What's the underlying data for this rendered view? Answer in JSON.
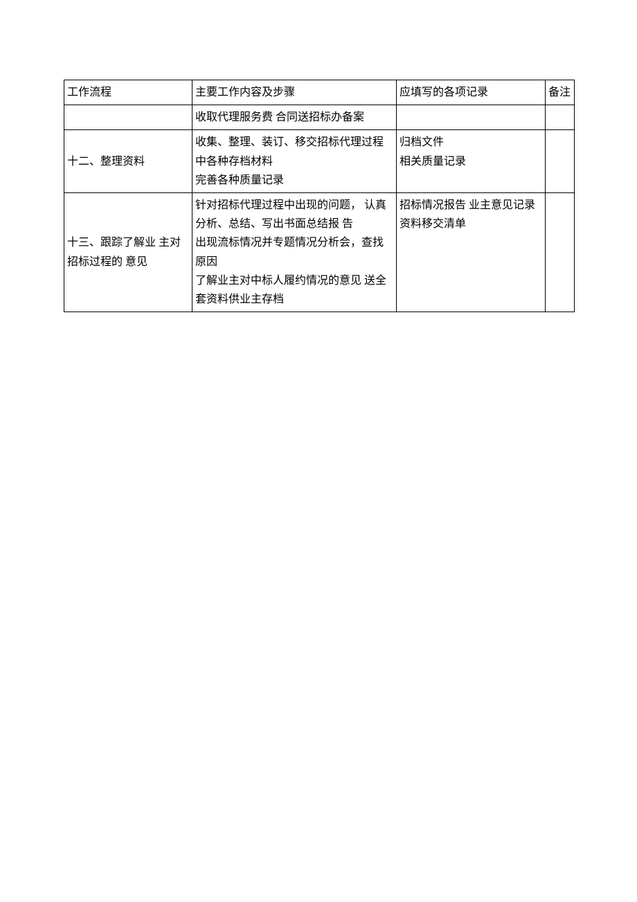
{
  "table": {
    "headers": {
      "col1": "工作流程",
      "col2": "主要工作内容及步骤",
      "col3": "应填写的各项记录",
      "col4": "备注"
    },
    "rows": [
      {
        "col1": "",
        "col2": "收取代理服务费 合同送招标办备案",
        "col3": "",
        "col4": ""
      },
      {
        "col1": "十二、整理资料",
        "col2": "收集、整理、装订、移交招标代理过程中各种存档材料\n完善各种质量记录",
        "col3": "归档文件\n相关质量记录",
        "col4": ""
      },
      {
        "col1": "十三、跟踪了解业  主对招标过程的  意见",
        "col2": "针对招标代理过程中出现的问题，  认真分析、总结、写出书面总结报  告\n出现流标情况并专题情况分析会，查找原因\n了解业主对中标人履约情况的意见 送全套资料供业主存档",
        "col3": "招标情况报告 业主意见记录 资料移交清单",
        "col4": ""
      }
    ]
  }
}
